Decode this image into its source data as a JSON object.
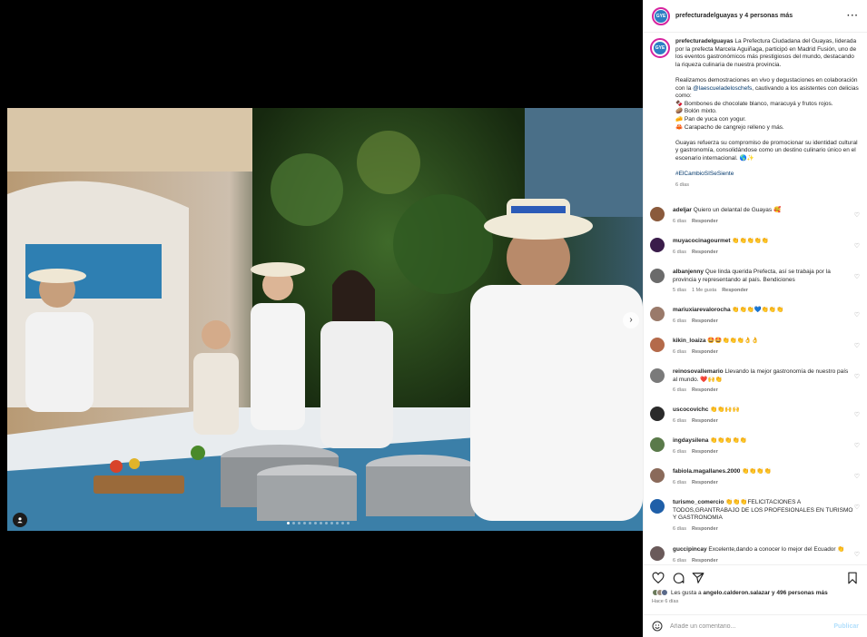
{
  "post": {
    "header_names": "prefecturadelguayas y 4 personas más",
    "more_icon": "ellipsis-icon",
    "caption": {
      "user": "prefecturadelguayas",
      "text1": " La Prefectura Ciudadana del Guayas, liderada por la prefecta Marcela Aguiñaga, participó en Madrid Fusión, uno de los eventos gastronómicos más prestigiosos del mundo, destacando la riqueza culinaria de nuestra provincia.",
      "text2_pre": "Realizamos demostraciones en vivo y degustaciones en colaboración con la ",
      "mention": "@laescueladeloschefs",
      "text2_post": ", cautivando a los asistentes con delicias como:",
      "items": [
        "🍫 Bombones de chocolate blanco, maracuyá y frutos rojos.",
        "🥔 Bolón mixto.",
        "🧀 Pan de yuca con yogur.",
        "🦀 Carapacho de cangrejo relleno y más."
      ],
      "text3": "Guayas refuerza su compromiso de promocionar su identidad cultural y gastronomía, consolidándose como un destino culinario único en el escenario internacional. 🌎✨",
      "hashtag": "#ElCambioSISeSiente",
      "age": "6 días"
    },
    "likes_text_pre": "Les gusta a ",
    "likes_user": "angelo.calderon.salazar",
    "likes_text_post": " y 496 personas más",
    "posted_ago": "Hace 6 días"
  },
  "comments": [
    {
      "user": "adeljar",
      "text": "Quiero un delantal de Guayas 🥰",
      "age": "6 días",
      "likes": "",
      "reply": "Responder",
      "avatar_color": "#8a5a3c"
    },
    {
      "user": "muyacocinagourmet",
      "text": "👏👏👏👏👏",
      "age": "6 días",
      "likes": "",
      "reply": "Responder",
      "avatar_color": "#3a1c4a"
    },
    {
      "user": "albanjenny",
      "text": "Que linda querida Prefecta, así se trabaja por la provincia y representando al país. Bendiciones",
      "age": "5 días",
      "likes": "1 Me gusta",
      "reply": "Responder",
      "avatar_color": "#6b6b6b"
    },
    {
      "user": "mariuxiarevalorocha",
      "text": "👏👏👏💙👏👏👏",
      "age": "6 días",
      "likes": "",
      "reply": "Responder",
      "avatar_color": "#9a7a6a"
    },
    {
      "user": "kikin_loaiza",
      "text": "🤩🤩👏👏👏👌👌",
      "age": "6 días",
      "likes": "",
      "reply": "Responder",
      "avatar_color": "#b46a4a"
    },
    {
      "user": "reinosovallemario",
      "text": "Llevando la mejor gastronomía de nuestro país al mundo. ❤️🙌👏",
      "age": "6 días",
      "likes": "",
      "reply": "Responder",
      "avatar_color": "#7a7a7a"
    },
    {
      "user": "uscocovichc",
      "text": "👏👏🙌🙌",
      "age": "6 días",
      "likes": "",
      "reply": "Responder",
      "avatar_color": "#2a2a2a"
    },
    {
      "user": "ingdaysilena",
      "text": "👏👏👏👏👏",
      "age": "6 días",
      "likes": "",
      "reply": "Responder",
      "avatar_color": "#5a7a4a"
    },
    {
      "user": "fabiola.magallanes.2000",
      "text": "👏👏👏👏",
      "age": "6 días",
      "likes": "",
      "reply": "Responder",
      "avatar_color": "#8a6a5a"
    },
    {
      "user": "turismo_comercio",
      "text": "👏👏👏FELICITACIONES A TODOS,GRANTRABAJO DE LOS PROFESIONALES EN TURISMO Y GASTRONOMIA",
      "age": "6 días",
      "likes": "",
      "reply": "Responder",
      "avatar_color": "#1f5fa8"
    },
    {
      "user": "guccipincay",
      "text": "Excelente,dando a conocer lo mejor del Ecuador 👏",
      "age": "6 días",
      "likes": "",
      "reply": "Responder",
      "avatar_color": "#6a5a5a"
    }
  ],
  "input": {
    "placeholder": "Añade un comentario...",
    "publish": "Publicar"
  },
  "icons": {
    "like": "heart-icon",
    "comment": "comment-icon",
    "share": "send-icon",
    "save": "bookmark-icon",
    "emoji": "emoji-icon",
    "next": "chevron-right-icon",
    "tag": "user-tag-icon"
  },
  "colors": {
    "link": "#00376b",
    "muted": "#737373",
    "publish": "#b2dffc"
  }
}
